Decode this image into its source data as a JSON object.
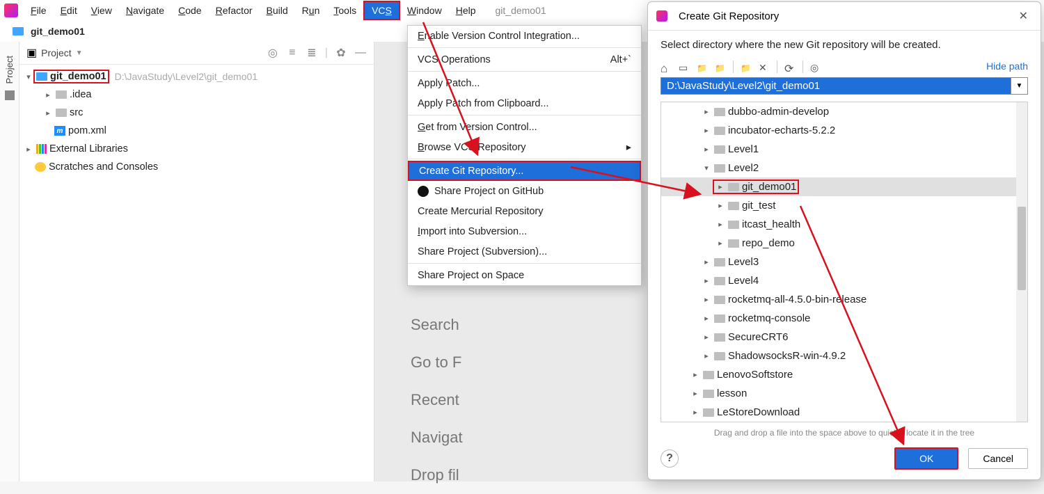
{
  "menubar": {
    "items": [
      "File",
      "Edit",
      "View",
      "Navigate",
      "Code",
      "Refactor",
      "Build",
      "Run",
      "Tools",
      "VCS",
      "Window",
      "Help"
    ],
    "active_index": 9,
    "project_name": "git_demo01"
  },
  "breadcrumb": {
    "text": "git_demo01"
  },
  "tool_strip": {
    "label": "Project"
  },
  "project_panel": {
    "header": "Project",
    "tree": {
      "root": {
        "label": "git_demo01",
        "path": "D:\\JavaStudy\\Level2\\git_demo01"
      },
      "children": [
        {
          "label": ".idea"
        },
        {
          "label": "src"
        },
        {
          "label": "pom.xml",
          "type": "m"
        }
      ],
      "ext_lib": "External Libraries",
      "scratches": "Scratches and Consoles"
    }
  },
  "welcome": {
    "lines": [
      "Search",
      "Go to F",
      "Recent",
      "Navigat",
      "Drop fil"
    ]
  },
  "vcs_menu": {
    "items": [
      {
        "label": "Enable Version Control Integration...",
        "u": 0
      },
      {
        "label": "VCS Operations",
        "shortcut": "Alt+`"
      },
      {
        "label": "Apply Patch..."
      },
      {
        "label": "Apply Patch from Clipboard..."
      },
      {
        "label": "Get from Version Control...",
        "u": 0
      },
      {
        "label": "Browse VCS Repository",
        "sub": true,
        "u": 0
      },
      {
        "label": "Create Git Repository...",
        "highlight": true
      },
      {
        "label": "Share Project on GitHub",
        "icon": "github"
      },
      {
        "label": "Create Mercurial Repository"
      },
      {
        "label": "Import into Subversion...",
        "u": 0
      },
      {
        "label": "Share Project (Subversion)..."
      },
      {
        "label": "Share Project on Space"
      }
    ]
  },
  "dialog": {
    "title": "Create Git Repository",
    "desc": "Select directory where the new Git repository will be created.",
    "hide_path": "Hide path",
    "path_value": "D:\\JavaStudy\\Level2\\git_demo01",
    "tree": [
      {
        "label": "dubbo-admin-develop",
        "level": 2
      },
      {
        "label": "incubator-echarts-5.2.2",
        "level": 2
      },
      {
        "label": "Level1",
        "level": 2
      },
      {
        "label": "Level2",
        "level": 2,
        "expanded": true
      },
      {
        "label": "git_demo01",
        "level": 3,
        "selected": true,
        "boxed": true
      },
      {
        "label": "git_test",
        "level": 3
      },
      {
        "label": "itcast_health",
        "level": 3
      },
      {
        "label": "repo_demo",
        "level": 3
      },
      {
        "label": "Level3",
        "level": 2
      },
      {
        "label": "Level4",
        "level": 2
      },
      {
        "label": "rocketmq-all-4.5.0-bin-release",
        "level": 2
      },
      {
        "label": "rocketmq-console",
        "level": 2
      },
      {
        "label": "SecureCRT6",
        "level": 2
      },
      {
        "label": "ShadowsocksR-win-4.9.2",
        "level": 2
      },
      {
        "label": "LenovoSoftstore",
        "level": 1
      },
      {
        "label": "lesson",
        "level": 1
      },
      {
        "label": "LeStoreDownload",
        "level": 1
      }
    ],
    "tiny_note": "Drag and drop a file into the space above to quickly locate it in the tree",
    "ok": "OK",
    "cancel": "Cancel"
  }
}
